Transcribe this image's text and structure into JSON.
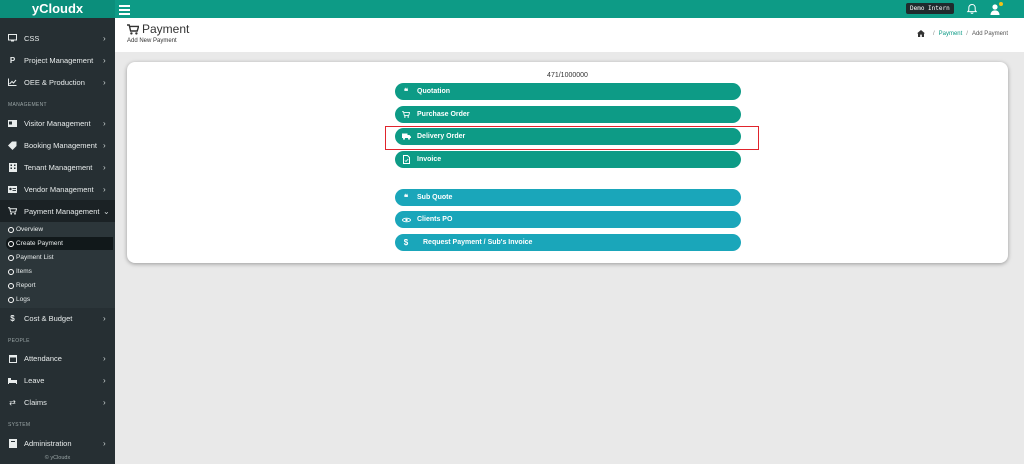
{
  "app": {
    "brand": "yCloudx",
    "user_badge": "Demo Intern",
    "copyright": "© yCloudx"
  },
  "sidebar": {
    "items_top": [
      {
        "label": "CSS",
        "icon": "monitor-icon"
      },
      {
        "label": "Project Management",
        "icon": "p-icon"
      },
      {
        "label": "OEE & Production",
        "icon": "chart-icon"
      }
    ],
    "section_management": "MANAGEMENT",
    "items_management": [
      {
        "label": "Visitor Management",
        "icon": "id-card-icon"
      },
      {
        "label": "Booking Management",
        "icon": "tag-icon"
      },
      {
        "label": "Tenant Management",
        "icon": "building-icon"
      },
      {
        "label": "Vendor Management",
        "icon": "vcard-icon"
      },
      {
        "label": "Payment Management",
        "icon": "cart-icon"
      }
    ],
    "payment_submenu": [
      {
        "label": "Overview"
      },
      {
        "label": "Create Payment"
      },
      {
        "label": "Payment List"
      },
      {
        "label": "Items"
      },
      {
        "label": "Report"
      },
      {
        "label": "Logs"
      }
    ],
    "cost_budget": "Cost & Budget",
    "section_people": "PEOPLE",
    "items_people": [
      {
        "label": "Attendance",
        "icon": "calendar-icon"
      },
      {
        "label": "Leave",
        "icon": "bed-icon"
      },
      {
        "label": "Claims",
        "icon": "exchange-icon"
      }
    ],
    "section_system": "SYSTEM",
    "administration": "Administration"
  },
  "header": {
    "title": "Payment",
    "subtitle": "Add New Payment",
    "breadcrumb": {
      "link": "Payment",
      "current": "Add Payment"
    }
  },
  "main": {
    "counter": "471/1000000",
    "teal_buttons": [
      {
        "label": "Quotation",
        "icon": "quote-icon"
      },
      {
        "label": "Purchase Order",
        "icon": "cart-icon"
      },
      {
        "label": "Delivery Order",
        "icon": "truck-icon"
      },
      {
        "label": "Invoice",
        "icon": "document-icon"
      }
    ],
    "blue_buttons": [
      {
        "label": "Sub Quote",
        "icon": "quote-icon"
      },
      {
        "label": "Clients PO",
        "icon": "eye-icon"
      },
      {
        "label": "Request Payment / Sub's Invoice",
        "icon": "dollar-icon"
      }
    ]
  },
  "colors": {
    "topbar": "#0d9b86",
    "sidebar": "#262f33",
    "teal_button": "#0d9b86",
    "blue_button": "#1aa6ba",
    "highlight": "#e0242c"
  }
}
